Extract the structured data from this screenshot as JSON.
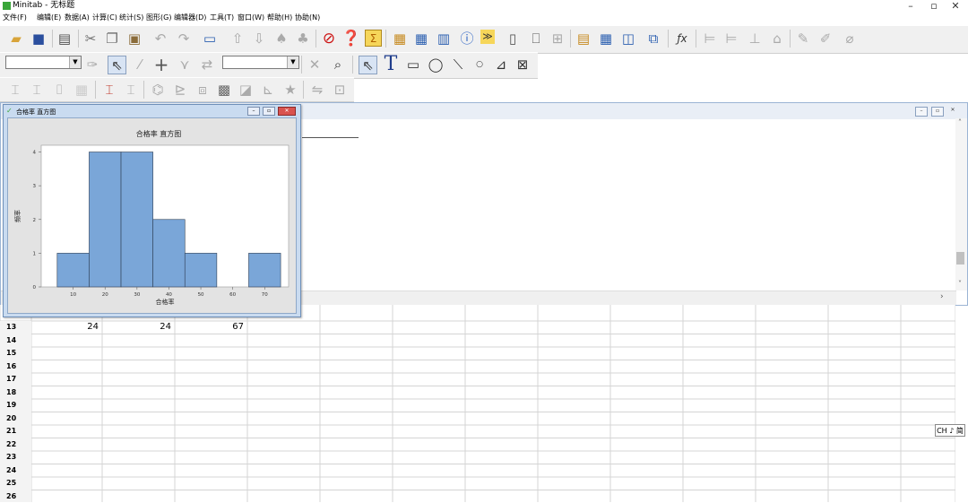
{
  "app": {
    "title": "Minitab - 无标题"
  },
  "menu": [
    "文件(F)",
    "编辑(E)",
    "数据(A)",
    "计算(C)",
    "统计(S)",
    "图形(G)",
    "编辑器(D)",
    "工具(T)",
    "窗口(W)",
    "帮助(H)",
    "协助(N)"
  ],
  "window_controls": {
    "minimize": "–",
    "maximize": "▫",
    "close": "✕"
  },
  "graph_window": {
    "title": "合格率 直方图",
    "chart_data": {
      "type": "bar",
      "title": "合格率 直方图",
      "xlabel": "合格率",
      "ylabel": "频率",
      "bin_edges": [
        5,
        15,
        25,
        35,
        45,
        55,
        65,
        75
      ],
      "x_ticks": [
        10,
        20,
        30,
        40,
        50,
        60,
        70
      ],
      "values": [
        1,
        4,
        4,
        2,
        1,
        0,
        1
      ],
      "y_ticks": [
        0,
        1,
        2,
        3,
        4
      ],
      "ylim": [
        0,
        4.2
      ],
      "bar_color": "#7aa6d8",
      "grid": false
    }
  },
  "worksheet": {
    "rows": [
      {
        "num": "13",
        "c1": "24",
        "c2": "24",
        "c3": "67"
      },
      {
        "num": "14"
      },
      {
        "num": "15"
      },
      {
        "num": "16"
      },
      {
        "num": "17"
      },
      {
        "num": "18"
      },
      {
        "num": "19"
      },
      {
        "num": "20"
      },
      {
        "num": "21"
      },
      {
        "num": "22"
      },
      {
        "num": "23"
      },
      {
        "num": "24"
      },
      {
        "num": "25"
      },
      {
        "num": "26"
      }
    ]
  },
  "ime_badge": "CH ♪ 简",
  "icons": {
    "toolbar1": [
      "open-icon",
      "save-icon",
      "print-icon",
      "cut-icon",
      "copy-icon",
      "paste-icon",
      "undo-icon",
      "redo-icon",
      "session-icon",
      "up-arrow-icon",
      "down-arrow-icon",
      "find-icon",
      "find-next-icon",
      "cancel-icon",
      "help-icon",
      "sigma-icon",
      "dialog-icon",
      "worksheet-icon",
      "graph-window-icon",
      "info-icon",
      "history-icon",
      "notes-icon",
      "new-doc-icon",
      "layout-icon",
      "report-icon",
      "table-icon",
      "panel-icon",
      "close-graphs-icon",
      "fx-icon",
      "align-left-icon",
      "align-right-icon",
      "bottom-icon",
      "brush-icon",
      "pen-icon",
      "pencil-icon",
      "eraser-icon"
    ],
    "toolbar2": [
      "brush-icon",
      "select-arrow-icon",
      "pencil-icon",
      "crosshair-icon",
      "flag-icon",
      "swap-icon",
      "close-icon",
      "zoom-icon",
      "select-arrow-icon",
      "text-icon",
      "rectangle-icon",
      "ellipse-icon",
      "line-icon",
      "dot-icon",
      "polyline-icon",
      "polygon-icon"
    ],
    "toolbar3": [
      "bracket-icon",
      "add-bracket-icon",
      "grid-icon",
      "grid2-icon",
      "red-bracket-icon",
      "bracket2-icon",
      "brush-icon",
      "layout-icon",
      "box-icon",
      "shade-icon",
      "brush2-icon",
      "axis-icon",
      "star-icon",
      "swap-icon",
      "table-icon"
    ]
  }
}
